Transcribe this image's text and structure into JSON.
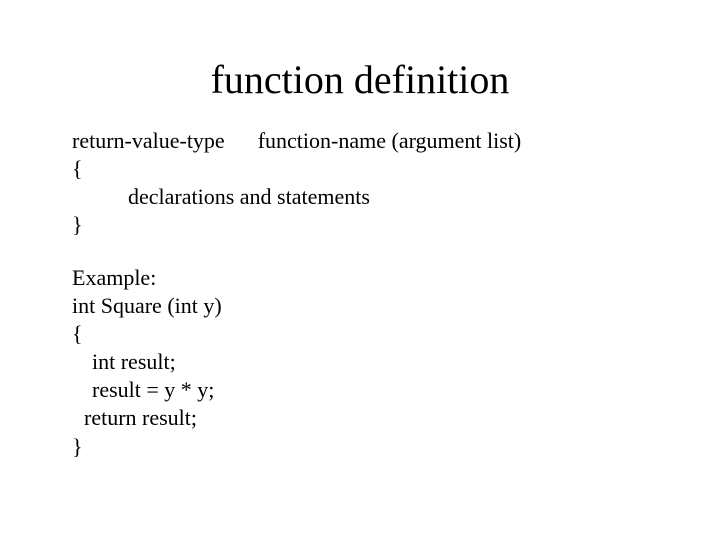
{
  "title": "function definition",
  "syntax": {
    "line1_left": "return-value-type",
    "line1_right": "function-name (argument list)",
    "open_brace": "{",
    "body": "declarations and statements",
    "close_brace": "}"
  },
  "example": {
    "label": "Example:",
    "sig": "int Square (int y)",
    "open_brace": "{",
    "decl": "int result;",
    "assign": "result = y * y;",
    "ret": "return result;",
    "close_brace": "}"
  }
}
